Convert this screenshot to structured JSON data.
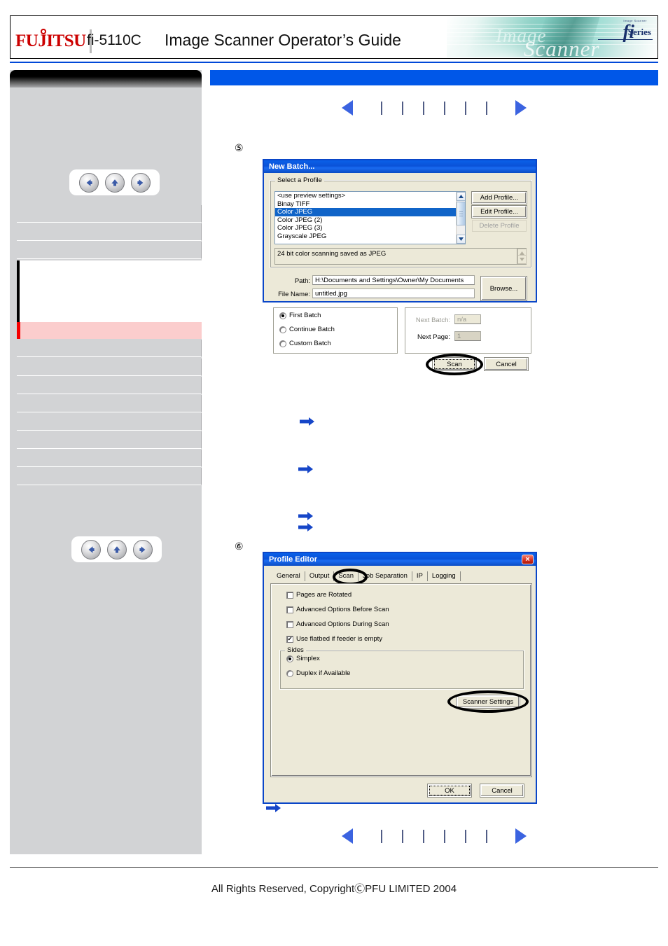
{
  "header": {
    "brand": "FUJITSU",
    "model": "fi-5110C",
    "title": "Image Scanner Operator’s Guide",
    "brand_art": {
      "fi": "fi",
      "series": "Series",
      "tiny": "Image Scanner",
      "word_image": "Image",
      "word_scanner": "Scanner"
    }
  },
  "sidebar": {
    "nav_top": {
      "back": "back-arrow",
      "up": "up-arrow",
      "forward": "forward-arrow"
    },
    "nav_bottom": {
      "back": "back-arrow",
      "up": "up-arrow",
      "forward": "forward-arrow"
    },
    "items": [
      {
        "label": "",
        "state": "normal"
      },
      {
        "label": "",
        "state": "normal"
      },
      {
        "label": "",
        "state": "normal"
      },
      {
        "label": "",
        "state": "expanded"
      },
      {
        "label": "",
        "state": "current"
      },
      {
        "label": "",
        "state": "normal"
      },
      {
        "label": "",
        "state": "normal"
      },
      {
        "label": "",
        "state": "normal"
      },
      {
        "label": "",
        "state": "normal"
      },
      {
        "label": "",
        "state": "normal"
      },
      {
        "label": "",
        "state": "normal"
      },
      {
        "label": "",
        "state": "normal"
      },
      {
        "label": "",
        "state": "normal"
      }
    ]
  },
  "content": {
    "pager_top": {
      "prev": "prev-page-arrow",
      "next": "next-page-arrow",
      "ticks": 6
    },
    "pager_bottom": {
      "prev": "prev-page-arrow",
      "next": "next-page-arrow",
      "ticks": 6
    },
    "step_5": "⑤",
    "step_6": "⑥",
    "arrow_bullets": [
      "arrow-bullet",
      "arrow-bullet",
      "arrow-bullet",
      "arrow-bullet",
      "arrow-bullet"
    ]
  },
  "new_batch_dialog": {
    "title": "New Batch...",
    "group_profile_legend": "Select a Profile",
    "profiles": [
      "<use preview settings>",
      "Binay TIFF",
      "Color JPEG",
      "Color JPEG (2)",
      "Color JPEG (3)",
      "Grayscale JPEG"
    ],
    "selected_profile": "Color JPEG",
    "selected_index": 2,
    "description": "24 bit color scanning saved as JPEG",
    "buttons": {
      "add_profile": "Add Profile...",
      "edit_profile": "Edit Profile...",
      "delete_profile": "Delete Profile",
      "browse": "Browse...",
      "scan": "Scan",
      "cancel": "Cancel"
    },
    "delete_profile_disabled": true,
    "fields": {
      "path_label": "Path:",
      "path_value": "H:\\Documents and Settings\\Owner\\My Documents",
      "file_name_label": "File Name:",
      "file_name_value": "untitled.jpg"
    },
    "batch_options": [
      {
        "label": "First Batch",
        "selected": true
      },
      {
        "label": "Continue Batch",
        "selected": false
      },
      {
        "label": "Custom Batch",
        "selected": false
      }
    ],
    "next_batch_label": "Next Batch:",
    "next_batch_value": "n/a",
    "next_page_label": "Next Page:",
    "next_page_value": "1",
    "next_batch_disabled": true,
    "highlight": "scan-button"
  },
  "profile_editor_dialog": {
    "title": "Profile Editor",
    "close_icon": "×",
    "tabs": [
      {
        "label": "General",
        "active": false
      },
      {
        "label": "Output",
        "active": false
      },
      {
        "label": "Scan",
        "active": true
      },
      {
        "label": "Job Separation",
        "active": false
      },
      {
        "label": "IP",
        "active": false
      },
      {
        "label": "Logging",
        "active": false
      }
    ],
    "checkboxes": [
      {
        "label": "Pages are Rotated",
        "checked": false
      },
      {
        "label": "Advanced Options Before Scan",
        "checked": false
      },
      {
        "label": "Advanced Options During Scan",
        "checked": false
      },
      {
        "label": "Use flatbed if feeder is empty",
        "checked": true
      }
    ],
    "sides_legend": "Sides",
    "sides_options": [
      {
        "label": "Simplex",
        "selected": true
      },
      {
        "label": "Duplex if Available",
        "selected": false
      }
    ],
    "buttons": {
      "scanner_settings": "Scanner Settings",
      "ok": "OK",
      "cancel": "Cancel"
    },
    "highlights": [
      "scan-tab",
      "scanner-settings-button"
    ]
  },
  "footer": {
    "copyright": "All Rights Reserved,  CopyrightⒸPFU LIMITED 2004"
  },
  "colors": {
    "accent_blue": "#0057e8",
    "title_blue": "#0a52d8",
    "dialog_face": "#ece9d8",
    "selection_blue": "#1064c8",
    "current_page_pink": "#fbcdcd",
    "current_page_red": "#f50000",
    "fujitsu_red": "#cc0000"
  }
}
